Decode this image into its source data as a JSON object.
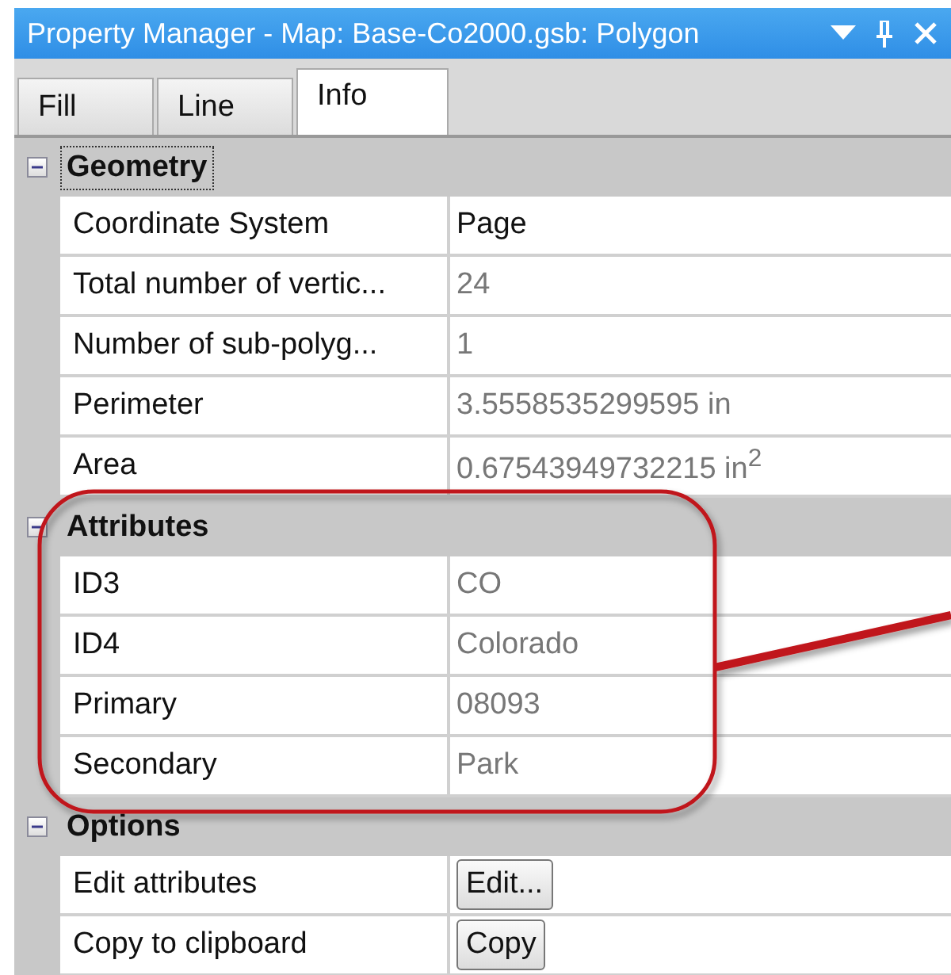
{
  "window": {
    "title": "Property Manager - Map: Base-Co2000.gsb: Polygon"
  },
  "tabs": [
    {
      "label": "Fill",
      "selected": false
    },
    {
      "label": "Line",
      "selected": false
    },
    {
      "label": "Info",
      "selected": true
    }
  ],
  "sections": [
    {
      "title": "Geometry",
      "expanded": true,
      "focused": true,
      "rows": [
        {
          "label": "Coordinate System",
          "kind": "text",
          "value": "Page",
          "readonly": false
        },
        {
          "label": "Total number of vertic...",
          "kind": "text",
          "value": "24",
          "readonly": true
        },
        {
          "label": "Number of sub-polyg...",
          "kind": "text",
          "value": "1",
          "readonly": true
        },
        {
          "label": "Perimeter",
          "kind": "text",
          "value": "3.5558535299595 in",
          "readonly": true
        },
        {
          "label": "Area",
          "kind": "text",
          "value": "0.67543949732215 in$^{2}$",
          "readonly": true
        }
      ]
    },
    {
      "title": "Attributes",
      "expanded": true,
      "focused": false,
      "rows": [
        {
          "label": "ID3",
          "kind": "text",
          "value": "CO",
          "readonly": true
        },
        {
          "label": "ID4",
          "kind": "text",
          "value": "Colorado",
          "readonly": true
        },
        {
          "label": "Primary",
          "kind": "text",
          "value": "08093",
          "readonly": true
        },
        {
          "label": "Secondary",
          "kind": "text",
          "value": "Park",
          "readonly": true
        }
      ]
    },
    {
      "title": "Options",
      "expanded": true,
      "focused": false,
      "rows": [
        {
          "label": "Edit attributes",
          "kind": "button",
          "value": "Edit..."
        },
        {
          "label": "Copy to clipboard",
          "kind": "button",
          "value": "Copy"
        }
      ]
    }
  ]
}
